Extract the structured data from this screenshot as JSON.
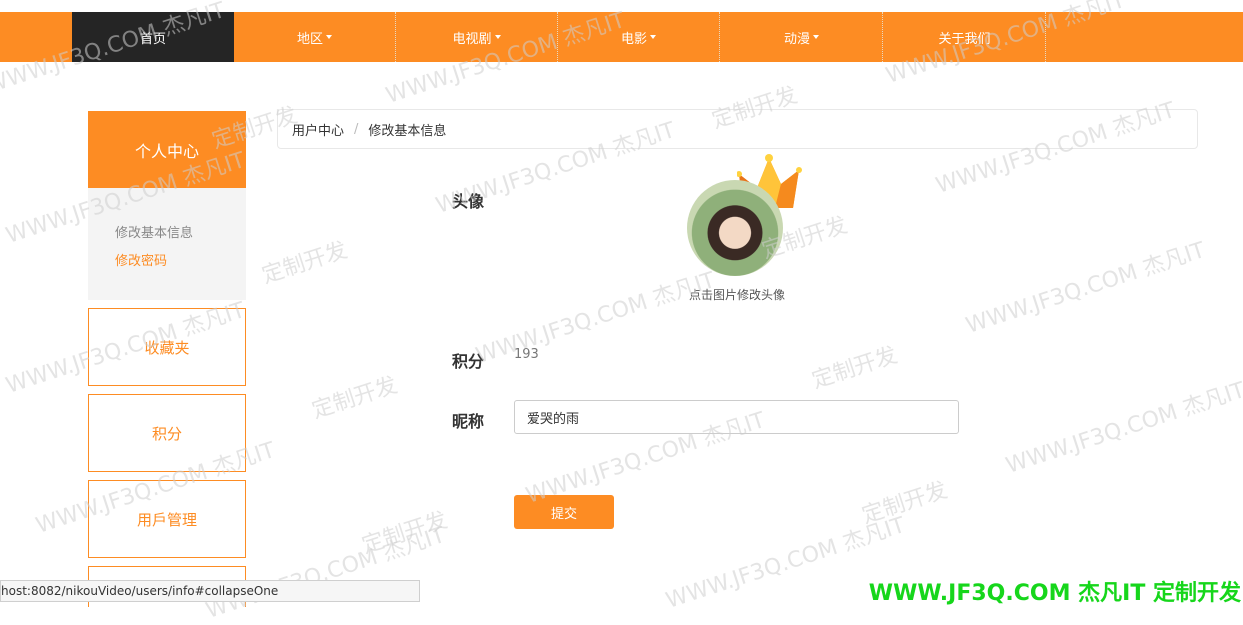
{
  "nav": {
    "home": "首页",
    "region": "地区",
    "tv": "电视剧",
    "movie": "电影",
    "anime": "动漫",
    "about": "关于我们"
  },
  "sidebar": {
    "header": "个人中心",
    "sub_items": [
      "修改基本信息",
      "修改密码"
    ],
    "cards": [
      "收藏夹",
      "积分",
      "用戶管理"
    ]
  },
  "breadcrumb": {
    "root": "用户中心",
    "separator": "/",
    "current": "修改基本信息"
  },
  "form": {
    "avatar_label": "头像",
    "avatar_hint": "点击图片修改头像",
    "score_label": "积分",
    "score_value": "193",
    "nickname_label": "昵称",
    "nickname_value": "爱哭的雨",
    "submit": "提交"
  },
  "status_bar": {
    "url": "host:8082/nikouVideo/users/info#collapseOne"
  },
  "watermark": {
    "site": "WWW.JF3Q.COM 杰凡IT",
    "slogan": "定制开发",
    "footer": "WWW.JF3Q.COM 杰凡IT  定制开发"
  },
  "colors": {
    "accent": "#fd8c23",
    "nav_active": "#252525",
    "sidebar_sub_bg": "#f4f4f4",
    "watermark_green": "#16d61b"
  }
}
